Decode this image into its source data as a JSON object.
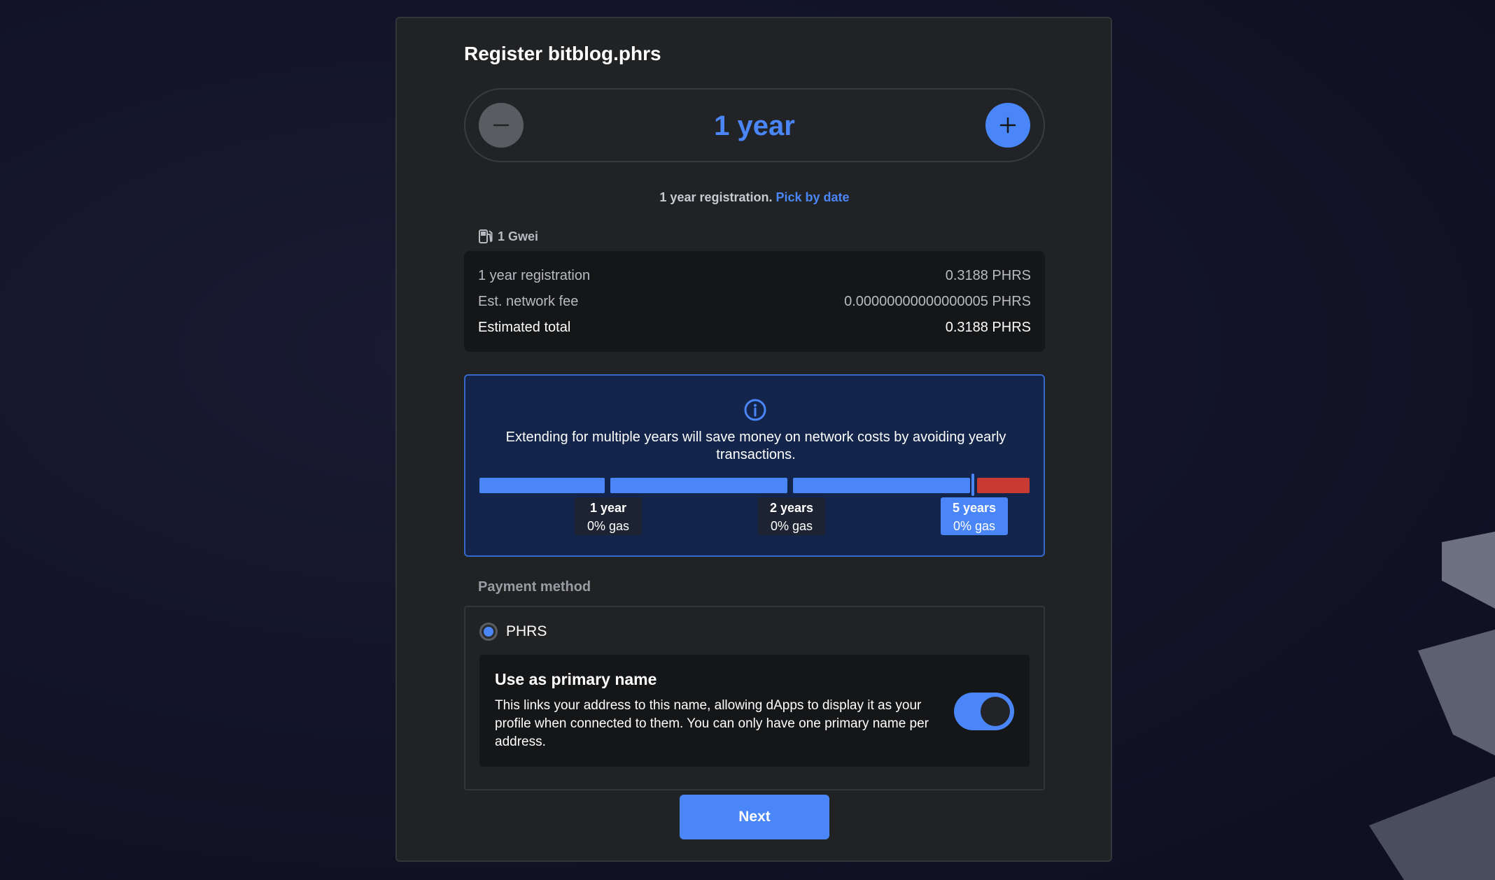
{
  "title": "Register bitblog.phrs",
  "duration": {
    "value": "1 year",
    "subtitle": "1 year registration.",
    "pick_by_date": "Pick by date"
  },
  "gas": {
    "price": "1 Gwei",
    "icon": "gas-pump-icon"
  },
  "fees": {
    "rows": [
      {
        "label": "1 year registration",
        "value": "0.3188 PHRS"
      },
      {
        "label": "Est. network fee",
        "value": "0.00000000000000005 PHRS"
      },
      {
        "label": "Estimated total",
        "value": "0.3188 PHRS"
      }
    ]
  },
  "info": {
    "message": "Extending for multiple years will save money on network costs by avoiding yearly transactions.",
    "ticks": [
      {
        "years": "1 year",
        "gas": "0% gas"
      },
      {
        "years": "2 years",
        "gas": "0% gas"
      },
      {
        "years": "5 years",
        "gas": "0% gas"
      }
    ]
  },
  "payment": {
    "label": "Payment method",
    "option": "PHRS",
    "selected": true,
    "primary_title": "Use as primary name",
    "primary_desc": "This links your address to this name, allowing dApps to display it as your profile when connected to them. You can only have one primary name per address.",
    "primary_enabled": true
  },
  "next_label": "Next",
  "colors": {
    "accent": "#4a86f7",
    "danger": "#c83b33",
    "card": "#212224",
    "info_bg": "#13254b"
  }
}
